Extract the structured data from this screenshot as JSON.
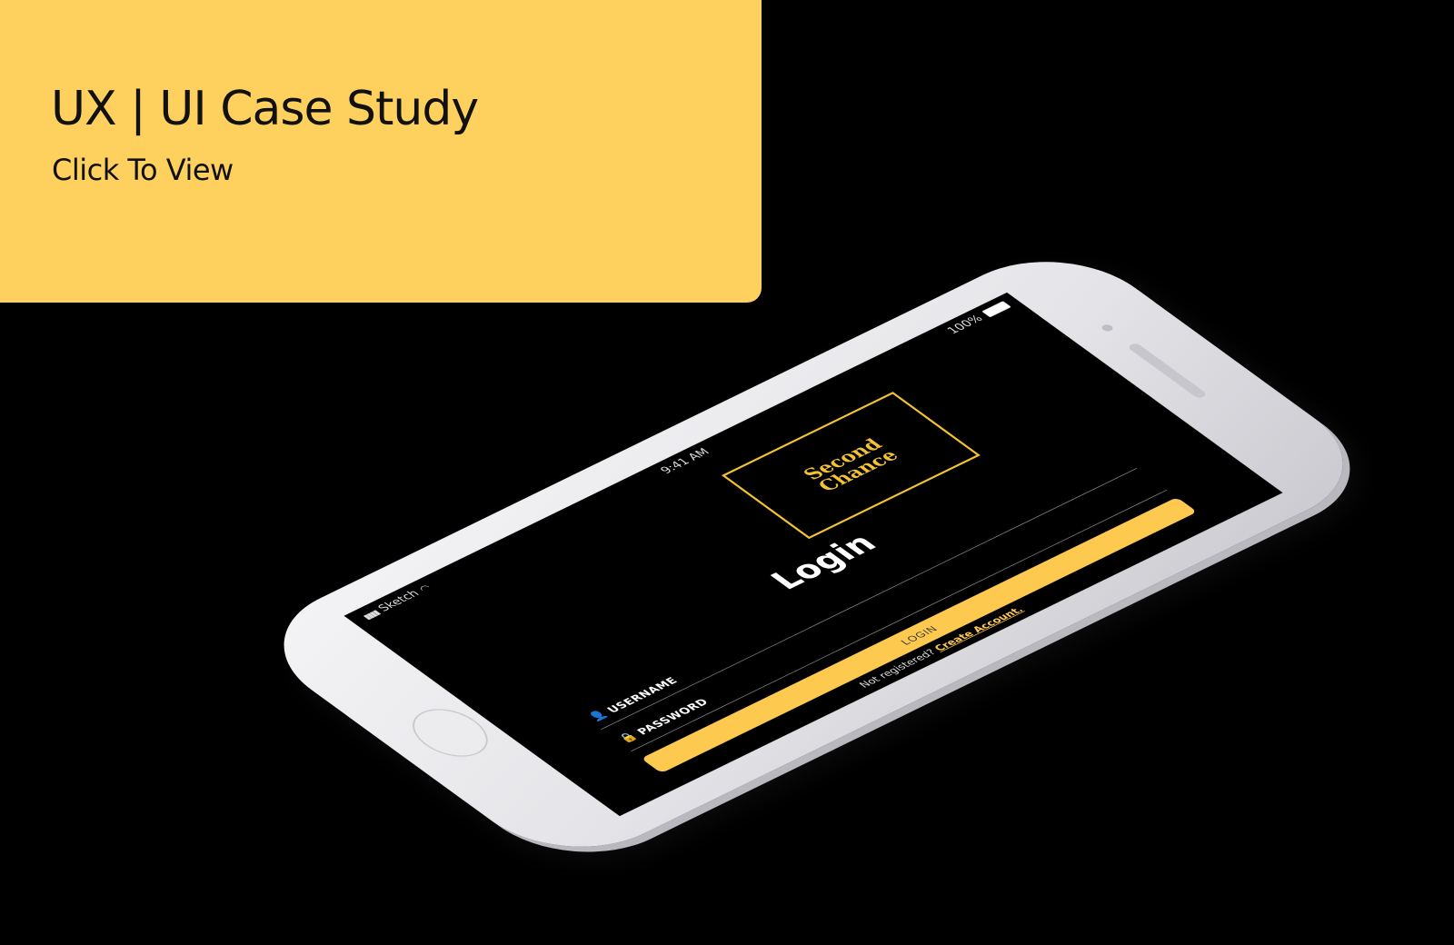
{
  "card": {
    "title": "UX | UI Case Study",
    "link_label": "Click To View"
  },
  "phone": {
    "status_bar": {
      "carrier": "Sketch",
      "time": "9:41 AM",
      "battery": "100%"
    },
    "logo": {
      "line1": "Second",
      "line2": "Chance"
    },
    "title": "Login",
    "username_label": "USERNAME",
    "password_label": "PASSWORD",
    "login_button": "LOGIN",
    "signup_prompt": "Not registered?",
    "signup_link": "Create Account."
  },
  "colors": {
    "accent": "#fed05e",
    "background": "#000000",
    "phone_body": "#e8e8ec"
  },
  "icons": {
    "username": "user-icon",
    "password": "lock-icon",
    "wifi": "wifi-icon",
    "signal": "signal-icon",
    "battery": "battery-icon"
  }
}
